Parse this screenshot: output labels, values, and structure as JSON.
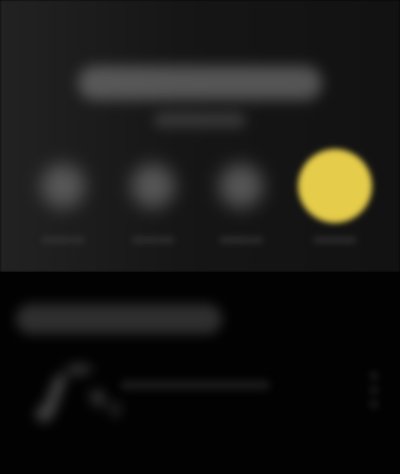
{
  "header": {
    "title": "",
    "subtitle": ""
  },
  "actions": [
    {
      "icon": "action-icon",
      "label": ""
    },
    {
      "icon": "action-icon",
      "label": ""
    },
    {
      "icon": "action-icon",
      "label": ""
    },
    {
      "icon": "primary-action-icon",
      "label": "",
      "active": true
    }
  ],
  "section": {
    "title": "",
    "items": [
      {
        "label": "",
        "icon": "music-note-icon",
        "menu_icon": "more-vertical-icon"
      }
    ]
  },
  "colors": {
    "accent": "#E5CC4A",
    "header_bg": "#1A1A1A",
    "body_bg": "#020202"
  }
}
